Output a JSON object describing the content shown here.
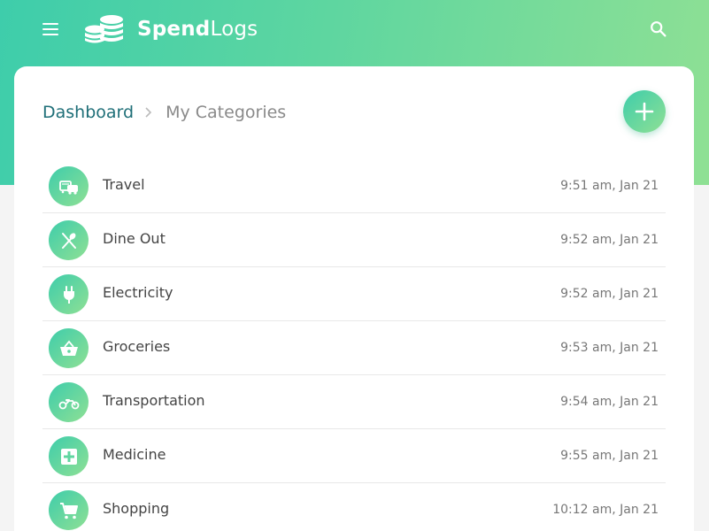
{
  "app": {
    "brand_bold": "Spend",
    "brand_light": "Logs"
  },
  "icons": {
    "menu": "menu-icon",
    "logo": "coin-stack-logo-icon",
    "search": "search-icon",
    "add": "plus-icon"
  },
  "colors": {
    "accent_start": "#3ecdab",
    "accent_end": "#8fe094",
    "breadcrumb_link": "#1f6f78"
  },
  "breadcrumb": {
    "parent": "Dashboard",
    "current": "My Categories"
  },
  "categories": [
    {
      "name": "Travel",
      "time": "9:51 am, Jan 21",
      "icon": "travel-icon"
    },
    {
      "name": "Dine Out",
      "time": "9:52 am, Jan 21",
      "icon": "fork-spoon-icon"
    },
    {
      "name": "Electricity",
      "time": "9:52 am, Jan 21",
      "icon": "plug-icon"
    },
    {
      "name": "Groceries",
      "time": "9:53 am, Jan 21",
      "icon": "basket-icon"
    },
    {
      "name": "Transportation",
      "time": "9:54 am, Jan 21",
      "icon": "motorbike-icon"
    },
    {
      "name": "Medicine",
      "time": "9:55 am, Jan 21",
      "icon": "medical-icon"
    },
    {
      "name": "Shopping",
      "time": "10:12 am, Jan 21",
      "icon": "cart-icon"
    }
  ]
}
